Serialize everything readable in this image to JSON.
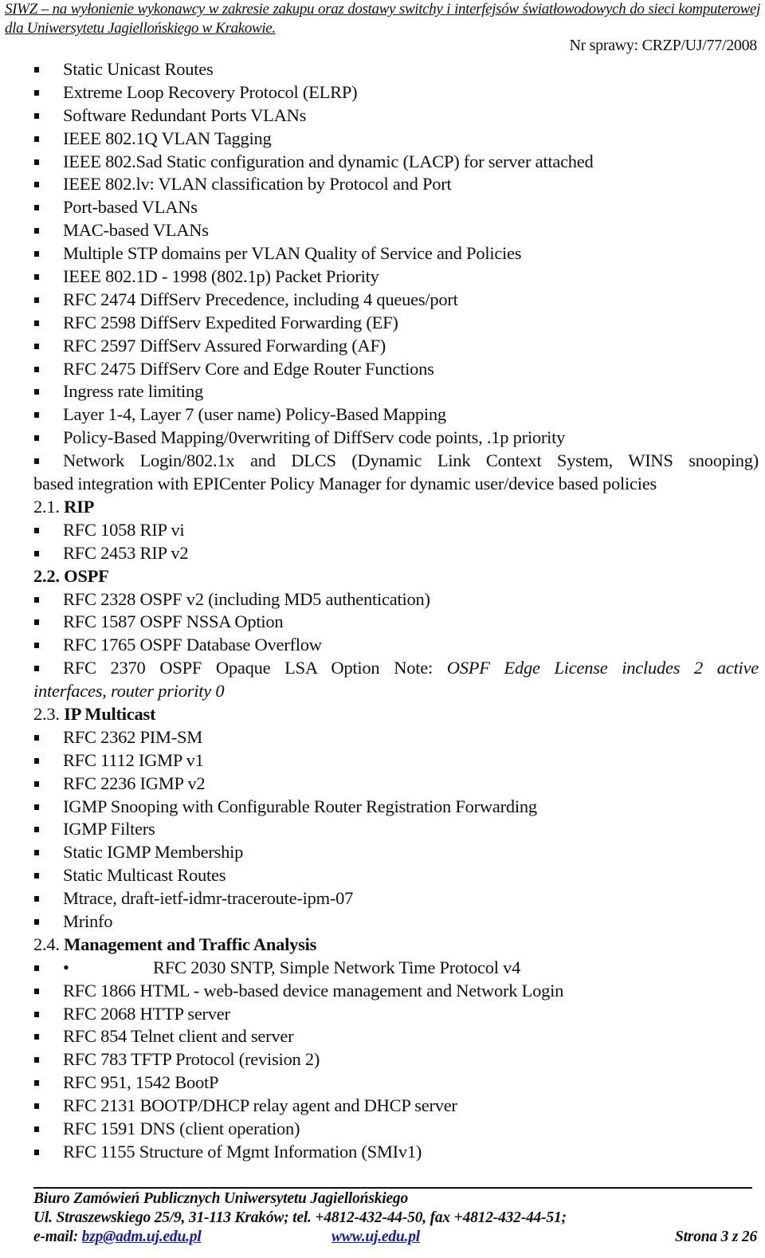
{
  "header": {
    "title": "SIWZ – na wyłonienie wykonawcy w zakresie zakupu oraz dostawy switchy i interfejsów światłowodowych do sieci komputerowej dla Uniwersytetu Jagiellońskiego w Krakowie.",
    "case_number": "Nr sprawy: CRZP/UJ/77/2008"
  },
  "intro_items": [
    "Static Unicast Routes",
    "Extreme Loop Recovery Protocol (ELRP)",
    "Software Redundant Ports VLANs",
    "IEEE 802.1Q VLAN Tagging",
    "IEEE 802.Sad Static configuration and dynamic (LACP) for server attached",
    "IEEE 802.lv: VLAN classification by Protocol and Port",
    "Port-based VLANs",
    "MAC-based VLANs",
    "Multiple STP domains per VLAN Quality of Service and Policies",
    "IEEE 802.1D - 1998 (802.1p) Packet Priority",
    "RFC 2474 DiffServ Precedence, including 4 queues/port",
    "RFC 2598 DiffServ Expedited Forwarding (EF)",
    "RFC 2597 DiffServ Assured Forwarding (AF)",
    "RFC 2475 DiffServ Core and Edge Router Functions",
    "Ingress rate limiting",
    "Layer 1-4, Layer 7 (user name) Policy-Based Mapping",
    "Policy-Based Mapping/0verwriting of DiffServ code points, .1p priority"
  ],
  "intro_wrap": {
    "first": "Network Login/802.1x and DLCS (Dynamic Link Context System, WINS snooping)",
    "rest": "based integration with EPICenter Policy Manager for dynamic user/device based policies"
  },
  "sections": {
    "rip": {
      "number": "2.1.",
      "title": "RIP",
      "items": [
        "RFC 1058 RIP vi",
        "RFC 2453 RIP v2"
      ]
    },
    "ospf": {
      "number": "2.2.",
      "title": "OSPF",
      "items": [
        "RFC 2328 OSPF v2 (including MD5 authentication)",
        "RFC 1587 OSPF NSSA Option",
        "RFC 1765 OSPF Database Overflow"
      ],
      "wrap_item": {
        "first_plain": "RFC 2370 OSPF Opaque LSA Option Note:",
        "first_italic": "OSPF Edge License includes 2 active",
        "rest_italic": "interfaces, router priority 0"
      }
    },
    "multicast": {
      "number": "2.3.",
      "title": "IP Multicast",
      "items": [
        "RFC 2362 PIM-SM",
        "RFC 1112 IGMP v1",
        "RFC 2236 IGMP v2",
        "IGMP Snooping with Configurable Router Registration Forwarding",
        "IGMP Filters",
        "Static IGMP Membership",
        "Static Multicast Routes",
        "Mtrace, draft-ietf-idmr-traceroute-ipm-07",
        "Mrinfo"
      ]
    },
    "management": {
      "number": "2.4.",
      "title": "Management and Traffic Analysis",
      "first_item_dot": "•",
      "first_item": "RFC 2030 SNTP, Simple Network Time Protocol v4",
      "items": [
        "RFC 1866 HTML - web-based device management and Network Login",
        "RFC 2068 HTTP server",
        "RFC 854 Telnet client and server",
        "RFC 783 TFTP Protocol (revision 2)",
        "RFC 951, 1542 BootP",
        "RFC 2131 BOOTP/DHCP relay agent and DHCP server",
        "RFC 1591 DNS (client operation)",
        "RFC 1155 Structure of Mgmt Information (SMIv1)"
      ]
    }
  },
  "footer": {
    "org": "Biuro Zamówień Publicznych Uniwersytetu Jagiellońskiego",
    "address": "Ul. Straszewskiego 25/9, 31-113 Kraków; tel. +4812-432-44-50, fax +4812-432-44-51;",
    "email_label": "e-mail: ",
    "email": "bzp@adm.uj.edu.pl",
    "website": "www.uj.edu.pl",
    "page": "Strona 3 z 26"
  }
}
